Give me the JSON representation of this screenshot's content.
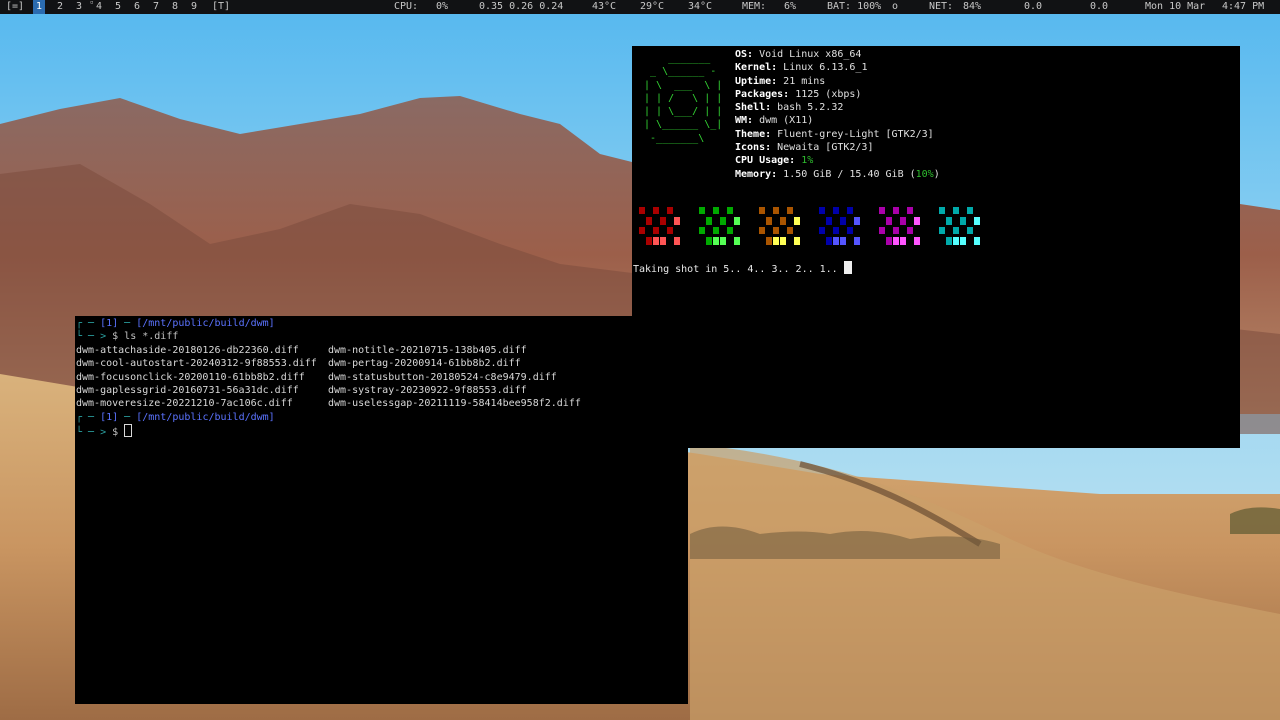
{
  "bar": {
    "layout": "[=]",
    "tags": [
      "1",
      "2",
      "3",
      "4",
      "5",
      "6",
      "7",
      "8",
      "9"
    ],
    "active_tag": "1",
    "float_tag": "[T]",
    "cpu_label": "CPU:",
    "cpu_value": "0%",
    "loadavg": "0.35 0.26 0.24",
    "temp1": "43°C",
    "temp2": "29°C",
    "temp3": "34°C",
    "mem_label": "MEM:",
    "mem_value": "6%",
    "bat_label": "BAT: 100%",
    "bat_icon": "o",
    "net_label": "NET:",
    "net_value": "84%",
    "net_down": "0.0",
    "net_up": "0.0",
    "date": "Mon 10 Mar",
    "time": "4:47 PM"
  },
  "term_left": {
    "prompt1": {
      "bracket_top": "┌ ─ ",
      "job": "[1]",
      "sep": " ─ ",
      "path": "[/mnt/public/build/dwm]",
      "bracket_bot": "└ ─ > ",
      "dollar": "$ ",
      "cmd": "ls *.diff"
    },
    "files_col1": [
      "dwm-attachaside-20180126-db22360.diff",
      "dwm-cool-autostart-20240312-9f88553.diff",
      "dwm-focusonclick-20200110-61bb8b2.diff",
      "dwm-gaplessgrid-20160731-56a31dc.diff",
      "dwm-moveresize-20221210-7ac106c.diff"
    ],
    "files_col2": [
      "dwm-notitle-20210715-138b405.diff",
      "dwm-pertag-20200914-61bb8b2.diff",
      "dwm-statusbutton-20180524-c8e9479.diff",
      "dwm-systray-20230922-9f88553.diff",
      "dwm-uselessgap-20211119-58414bee958f2.diff"
    ],
    "prompt2": {
      "bracket_top": "┌ ─ ",
      "job": "[1]",
      "sep": " ─ ",
      "path": "[/mnt/public/build/dwm]",
      "bracket_bot": "└ ─ > ",
      "dollar": "$ "
    }
  },
  "term_right": {
    "logo": [
      "     _______",
      "  _ \\______ -",
      " | \\  ___  \\ |",
      " | | /   \\ | |",
      " | | \\___/ | |",
      " | \\______ \\_|",
      "  -_______\\"
    ],
    "info": [
      {
        "k": "OS:",
        "v": " Void Linux x86_64"
      },
      {
        "k": "Kernel:",
        "v": " Linux 6.13.6_1"
      },
      {
        "k": "Uptime:",
        "v": " 21 mins"
      },
      {
        "k": "Packages:",
        "v": " 1125 (xbps)"
      },
      {
        "k": "Shell:",
        "v": " bash 5.2.32"
      },
      {
        "k": "WM:",
        "v": " dwm (X11)"
      },
      {
        "k": "Theme:",
        "v": " Fluent-grey-Light [GTK2/3]"
      },
      {
        "k": "Icons:",
        "v": " Newaita [GTK2/3]"
      }
    ],
    "cpu_usage_label": "CPU Usage:",
    "cpu_usage_value": "1%",
    "memory_label": "Memory:",
    "memory_value": " 1.50 GiB / 15.40 GiB (",
    "memory_pct": "10%",
    "memory_close": ")",
    "palette_colors": [
      [
        "#aa0000",
        "#ff5555"
      ],
      [
        "#00aa00",
        "#55ff55"
      ],
      [
        "#aa5500",
        "#ffff55"
      ],
      [
        "#0000aa",
        "#5555ff"
      ],
      [
        "#aa00aa",
        "#ff55ff"
      ],
      [
        "#00aaaa",
        "#55ffff"
      ]
    ],
    "shot_text": "Taking shot in 5.. 4.. 3.. 2.. 1.. "
  }
}
